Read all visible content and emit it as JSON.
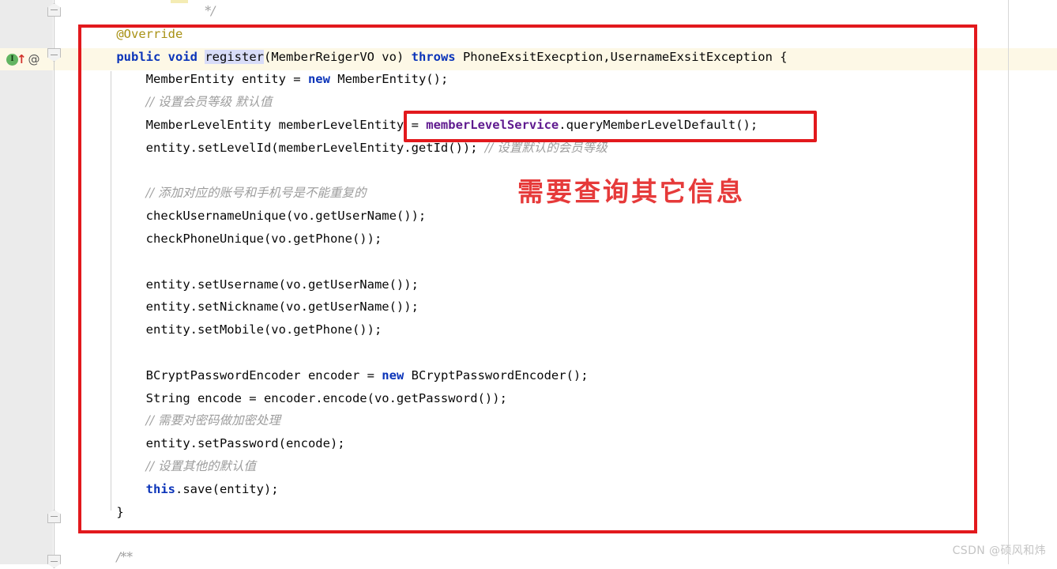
{
  "editor": {
    "gutter": {
      "implementation_icon": "implemented-method-icon",
      "implementation_letter": "I",
      "override_icon": "at-override-icon",
      "override_glyph": "@",
      "up_arrow_glyph": "↑",
      "fold_minus_glyph": "−"
    },
    "colors": {
      "keyword": "#0b34b9",
      "annotation": "#a89114",
      "comment": "#9d9d9d",
      "field": "#5f1a8f",
      "caret_line_bg": "#fdf8e6",
      "gutter_bg": "#ebebeb",
      "editor_bg": "#ffffff",
      "highlight_red": "#e2191d",
      "note_red": "#e63a3a",
      "identifier_highlight_bg": "#d8dcf8"
    },
    "lines": [
      {
        "id": "line-comment-close",
        "indent": 4,
        "parts": [
          {
            "t": "*/",
            "c": "cmt"
          }
        ]
      },
      {
        "id": "line-override",
        "indent": 1,
        "parts": [
          {
            "t": "@Override",
            "c": "anno"
          }
        ]
      },
      {
        "id": "line-signature",
        "indent": 1,
        "parts": [
          {
            "t": "public",
            "c": "kw"
          },
          {
            "t": " ",
            "c": "plain"
          },
          {
            "t": "void",
            "c": "kw"
          },
          {
            "t": " ",
            "c": "plain"
          },
          {
            "t": "register",
            "c": "plain ident-hl"
          },
          {
            "t": "(MemberReigerVO vo) ",
            "c": "plain"
          },
          {
            "t": "throws",
            "c": "kw"
          },
          {
            "t": " PhoneExsitExecption,UsernameExsitException {",
            "c": "plain"
          }
        ]
      },
      {
        "id": "line-new-entity",
        "indent": 2,
        "parts": [
          {
            "t": "MemberEntity entity = ",
            "c": "plain"
          },
          {
            "t": "new",
            "c": "kw"
          },
          {
            "t": " MemberEntity();",
            "c": "plain"
          }
        ]
      },
      {
        "id": "line-comment-level",
        "indent": 2,
        "parts": [
          {
            "t": "// 设置会员等级 默认值",
            "c": "cmt"
          }
        ]
      },
      {
        "id": "line-query-default",
        "indent": 2,
        "parts": [
          {
            "t": "MemberLevelEntity memberLevelEntity = ",
            "c": "plain"
          },
          {
            "t": "memberLevelService",
            "c": "field"
          },
          {
            "t": ".queryMemberLevelDefault();",
            "c": "plain"
          }
        ]
      },
      {
        "id": "line-set-levelid",
        "indent": 2,
        "parts": [
          {
            "t": "entity.setLevelId(memberLevelEntity.getId()); ",
            "c": "plain"
          },
          {
            "t": "// 设置默认的会员等级",
            "c": "cmt"
          }
        ]
      },
      {
        "id": "line-blank-1",
        "indent": 0,
        "parts": [
          {
            "t": " ",
            "c": "plain"
          }
        ]
      },
      {
        "id": "line-comment-unique",
        "indent": 2,
        "parts": [
          {
            "t": "// 添加对应的账号和手机号是不能重复的",
            "c": "cmt"
          }
        ]
      },
      {
        "id": "line-check-username",
        "indent": 2,
        "parts": [
          {
            "t": "checkUsernameUnique(vo.getUserName());",
            "c": "plain"
          }
        ]
      },
      {
        "id": "line-check-phone",
        "indent": 2,
        "parts": [
          {
            "t": "checkPhoneUnique(vo.getPhone());",
            "c": "plain"
          }
        ]
      },
      {
        "id": "line-blank-2",
        "indent": 0,
        "parts": [
          {
            "t": " ",
            "c": "plain"
          }
        ]
      },
      {
        "id": "line-set-username",
        "indent": 2,
        "parts": [
          {
            "t": "entity.setUsername(vo.getUserName());",
            "c": "plain"
          }
        ]
      },
      {
        "id": "line-set-nickname",
        "indent": 2,
        "parts": [
          {
            "t": "entity.setNickname(vo.getUserName());",
            "c": "plain"
          }
        ]
      },
      {
        "id": "line-set-mobile",
        "indent": 2,
        "parts": [
          {
            "t": "entity.setMobile(vo.getPhone());",
            "c": "plain"
          }
        ]
      },
      {
        "id": "line-blank-3",
        "indent": 0,
        "parts": [
          {
            "t": " ",
            "c": "plain"
          }
        ]
      },
      {
        "id": "line-new-encoder",
        "indent": 2,
        "parts": [
          {
            "t": "BCryptPasswordEncoder encoder = ",
            "c": "plain"
          },
          {
            "t": "new",
            "c": "kw"
          },
          {
            "t": " BCryptPasswordEncoder();",
            "c": "plain"
          }
        ]
      },
      {
        "id": "line-encode",
        "indent": 2,
        "parts": [
          {
            "t": "String encode = encoder.encode(vo.getPassword());",
            "c": "plain"
          }
        ]
      },
      {
        "id": "line-comment-encrypt",
        "indent": 2,
        "parts": [
          {
            "t": "// 需要对密码做加密处理",
            "c": "cmt"
          }
        ]
      },
      {
        "id": "line-set-password",
        "indent": 2,
        "parts": [
          {
            "t": "entity.setPassword(encode);",
            "c": "plain"
          }
        ]
      },
      {
        "id": "line-comment-other-default",
        "indent": 2,
        "parts": [
          {
            "t": "// 设置其他的默认值",
            "c": "cmt"
          }
        ]
      },
      {
        "id": "line-save",
        "indent": 2,
        "parts": [
          {
            "t": "this",
            "c": "kw"
          },
          {
            "t": ".save(entity);",
            "c": "plain"
          }
        ]
      },
      {
        "id": "line-close-brace",
        "indent": 1,
        "parts": [
          {
            "t": "}",
            "c": "plain"
          }
        ]
      },
      {
        "id": "line-blank-4",
        "indent": 0,
        "parts": [
          {
            "t": " ",
            "c": "plain"
          }
        ]
      },
      {
        "id": "line-javadoc-open",
        "indent": 1,
        "parts": [
          {
            "t": "/**",
            "c": "cmt"
          }
        ]
      }
    ]
  },
  "annotations": {
    "red_frame_label": "method-highlight-frame",
    "red_inline_label": "service-call-highlight-frame",
    "red_note_text": "需要查询其它信息"
  },
  "watermark": {
    "text": "CSDN @硕风和炜"
  }
}
